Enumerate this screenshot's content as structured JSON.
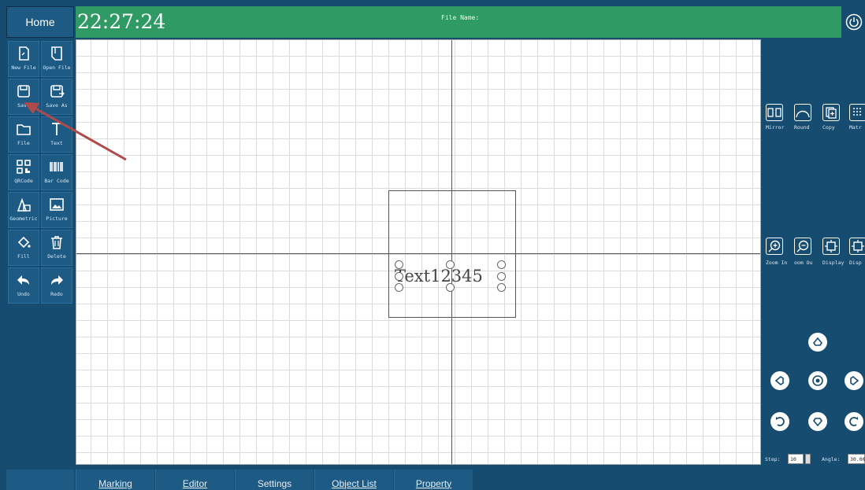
{
  "header": {
    "home_label": "Home",
    "clock": "22:27:24",
    "file_name_label": "File Name:"
  },
  "left_toolbar": {
    "items": [
      {
        "label": "New File",
        "icon": "new-file-icon"
      },
      {
        "label": "Open File",
        "icon": "open-file-icon"
      },
      {
        "label": "Save",
        "icon": "save-icon"
      },
      {
        "label": "Save As",
        "icon": "save-as-icon"
      },
      {
        "label": "File",
        "icon": "folder-icon"
      },
      {
        "label": "Text",
        "icon": "text-icon"
      },
      {
        "label": "QRCode",
        "icon": "qrcode-icon"
      },
      {
        "label": "Bar Code",
        "icon": "barcode-icon"
      },
      {
        "label": "Geometric",
        "icon": "geometric-icon"
      },
      {
        "label": "Picture",
        "icon": "picture-icon"
      },
      {
        "label": "Fill",
        "icon": "fill-icon"
      },
      {
        "label": "Delete",
        "icon": "trash-icon"
      },
      {
        "label": "Undo",
        "icon": "undo-icon"
      },
      {
        "label": "Redo",
        "icon": "redo-icon"
      }
    ]
  },
  "canvas": {
    "object_text": "Text12345"
  },
  "right_toolbar": {
    "row1": [
      {
        "label": "Mirror",
        "icon": "mirror-icon"
      },
      {
        "label": "Round",
        "icon": "round-icon"
      },
      {
        "label": "Copy",
        "icon": "copy-icon"
      },
      {
        "label": "Matr",
        "icon": "matrix-icon"
      }
    ],
    "row2": [
      {
        "label": "Zoom In",
        "icon": "zoom-in-icon"
      },
      {
        "label": "oom Ou",
        "icon": "zoom-out-icon"
      },
      {
        "label": "Display",
        "icon": "display-icon"
      },
      {
        "label": "Disp",
        "icon": "display-icon"
      }
    ],
    "step_label": "Step:",
    "step_value": "10",
    "angle_label": "Angle:",
    "angle_value": "30.00"
  },
  "bottom_tabs": [
    "Marking",
    "Editor",
    "Settings",
    "Object List",
    "Property"
  ],
  "colors": {
    "frame": "#174c71",
    "header": "#2f9a63",
    "annotation_arrow": "#b04a4a"
  }
}
